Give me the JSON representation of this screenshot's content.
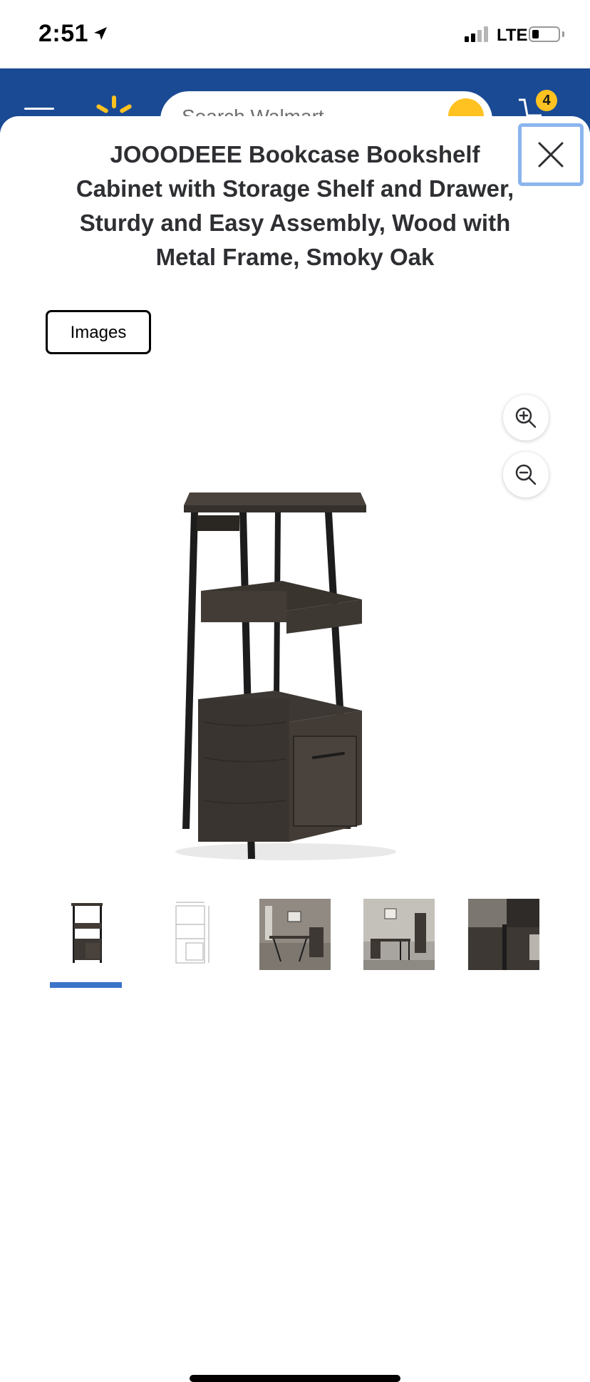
{
  "status_bar": {
    "time": "2:51",
    "network": "LTE"
  },
  "header": {
    "search_placeholder": "Search Walmart",
    "cart_count": "4"
  },
  "modal": {
    "title": "JOOODEEE Bookcase Bookshelf Cabinet with Storage Shelf and Drawer, Sturdy and Easy Assembly, Wood with Metal Frame, Smoky Oak",
    "images_button_label": "Images",
    "thumbnails": [
      {
        "kind": "product-front",
        "selected": true
      },
      {
        "kind": "dimension-diagram",
        "selected": false
      },
      {
        "kind": "room-scene-desk",
        "selected": false
      },
      {
        "kind": "room-scene-chair",
        "selected": false
      },
      {
        "kind": "detail-closeup",
        "selected": false
      }
    ]
  },
  "colors": {
    "header_blue": "#1a4a94",
    "spark_yellow": "#ffc220",
    "focus_ring": "#8bb5ee",
    "thumb_indicator": "#3b74c8",
    "wood_dark": "#3d3833",
    "frame_black": "#1c1c1c"
  },
  "icons": [
    "location-arrow-icon",
    "signal-icon",
    "battery-icon",
    "menu-icon",
    "walmart-spark-icon",
    "search-icon",
    "cart-icon",
    "close-icon",
    "zoom-in-icon",
    "zoom-out-icon"
  ]
}
